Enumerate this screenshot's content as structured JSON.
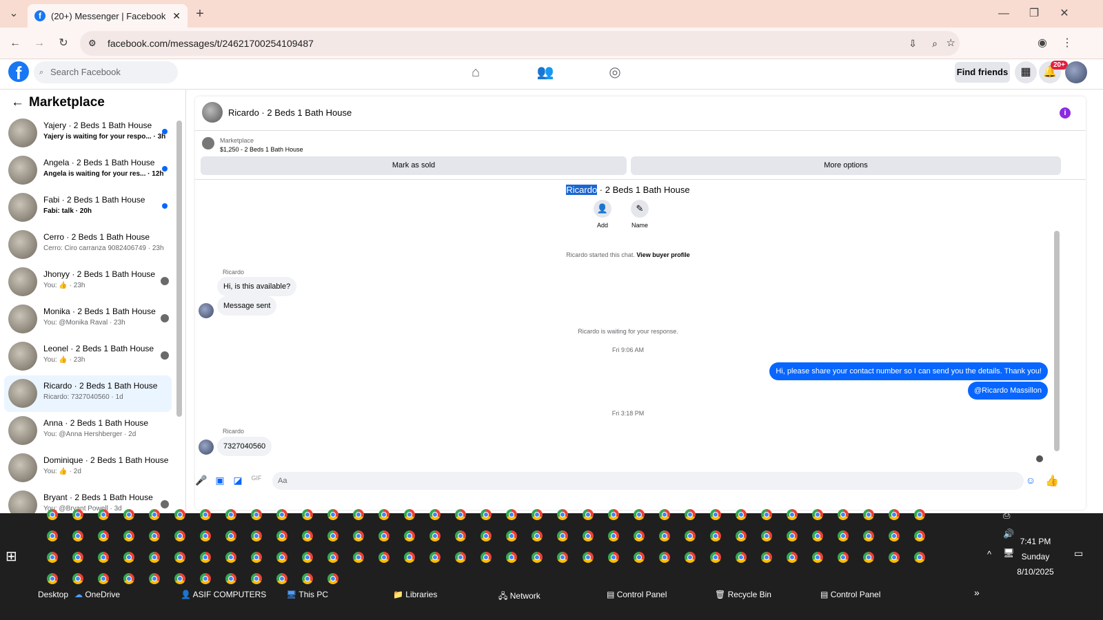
{
  "browser": {
    "tab_title": "(20+) Messenger | Facebook",
    "url": "facebook.com/messages/t/24621700254109487"
  },
  "fb": {
    "search_placeholder": "Search Facebook",
    "find_friends": "Find friends",
    "notif_badge": "20+"
  },
  "sidebar": {
    "title": "Marketplace",
    "items": [
      {
        "title": "Yajery · 2 Beds 1 Bath House",
        "sub": "Yajery is waiting for your respo... · 3h",
        "unread": true
      },
      {
        "title": "Angela · 2 Beds 1 Bath House",
        "sub": "Angela is waiting for your res... · 12h",
        "unread": true
      },
      {
        "title": "Fabi · 2 Beds 1 Bath House",
        "sub": "Fabi: talk · 20h",
        "unread": true
      },
      {
        "title": "Cerro · 2 Beds 1 Bath House",
        "sub": "Cerro: Ciro carranza 9082406749 · 23h",
        "unread": false
      },
      {
        "title": "Jhonyy · 2 Beds 1 Bath House",
        "sub": "You: 👍 · 23h",
        "unread": false
      },
      {
        "title": "Monika · 2 Beds 1 Bath House",
        "sub": "You: @Monika Raval · 23h",
        "unread": false
      },
      {
        "title": "Leonel · 2 Beds 1 Bath House",
        "sub": "You: 👍 · 23h",
        "unread": false
      },
      {
        "title": "Ricardo · 2 Beds 1 Bath House",
        "sub": "Ricardo: 7327040560 · 1d",
        "unread": false
      },
      {
        "title": "Anna · 2 Beds 1 Bath House",
        "sub": "You: @Anna Hershberger · 2d",
        "unread": false
      },
      {
        "title": "Dominique · 2 Beds 1 Bath House",
        "sub": "You: 👍 · 2d",
        "unread": false
      },
      {
        "title": "Bryant · 2 Beds 1 Bath House",
        "sub": "You: @Bryant Powell · 3d",
        "unread": false
      }
    ]
  },
  "chat": {
    "header": "Ricardo · 2 Beds 1 Bath House",
    "marketplace_label": "Marketplace",
    "listing": "$1,250 - 2 Beds 1 Bath House",
    "mark_sold": "Mark as sold",
    "more_options": "More options",
    "title_name": "Ricardo",
    "title_rest": " · 2 Beds 1 Bath House",
    "add": "Add",
    "name": "Name",
    "started": "Ricardo started this chat. ",
    "view_profile": "View buyer profile",
    "sender": "Ricardo",
    "msg1": "Hi, is this available?",
    "msg2": "Message sent",
    "waiting": "Ricardo is waiting for your response.",
    "time1": "Fri 9:06 AM",
    "out1": "Hi, please share your contact number so I can send you the details. Thank you!",
    "out2": "@Ricardo Massillon",
    "time2": "Fri 3:18 PM",
    "msg3": "7327040560",
    "composer_placeholder": "Aa"
  },
  "taskbar": {
    "desktop": "Desktop",
    "onedrive": "OneDrive",
    "asif": "ASIF COMPUTERS",
    "thispc": "This PC",
    "libraries": "Libraries",
    "network": "Network",
    "cp1": "Control Panel",
    "recycle": "Recycle Bin",
    "cp2": "Control Panel",
    "time": "7:41 PM",
    "day": "Sunday",
    "date": "8/10/2025"
  }
}
